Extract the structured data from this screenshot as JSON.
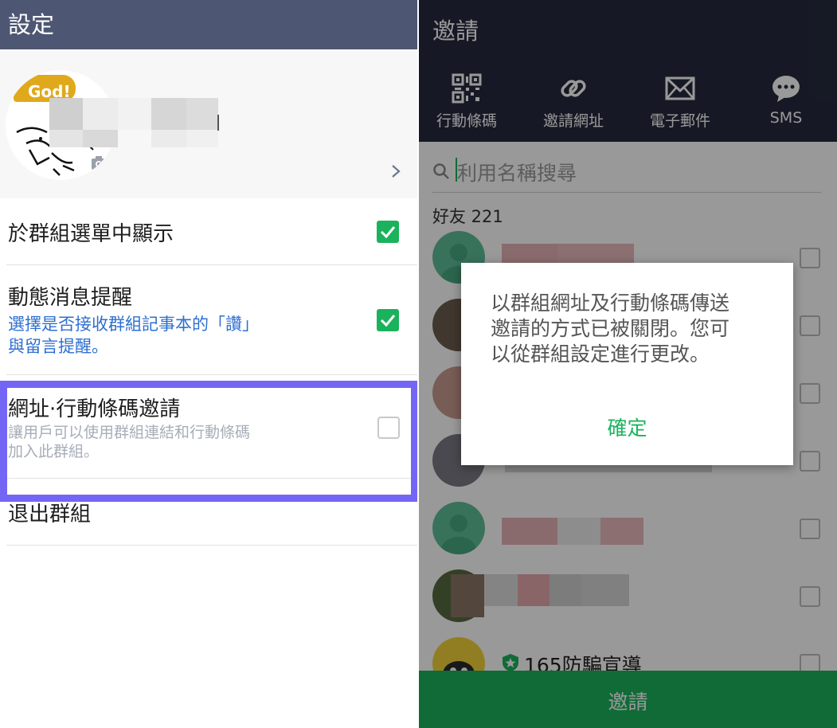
{
  "left": {
    "header": {
      "title": "設定"
    },
    "profile": {
      "avatar_badge": "God!",
      "chevron_icon": "chevron-right-icon",
      "camera_icon": "camera-icon"
    },
    "rows": [
      {
        "title": "於群組選單中顯示",
        "checked": true
      },
      {
        "title": "動態消息提醒",
        "subtitle": "選擇是否接收群組記事本的「讚」與留言提醒。",
        "checked": true
      },
      {
        "title": "網址·行動條碼邀請",
        "subtitle": "讓用戶可以使用群組連結和行動條碼加入此群組。",
        "checked": false
      },
      {
        "title": "退出群組"
      }
    ],
    "subtitle_lines": {
      "row1_line1": "選擇是否接收群組記事本的「讚」",
      "row1_line2": "與留言提醒。",
      "row2_line1": "讓用戶可以使用群組連結和行動條碼",
      "row2_line2": "加入此群組。"
    },
    "colors": {
      "header": "#4d5672",
      "check_on": "#1bb25c",
      "subtitle_blue": "#2d6fd1",
      "subtitle_gray": "#a7adb8",
      "highlight": "#7466f4"
    }
  },
  "right": {
    "header": {
      "title": "邀請"
    },
    "share_options": [
      {
        "label": "行動條碼",
        "icon": "qr-code-icon"
      },
      {
        "label": "邀請網址",
        "icon": "link-icon"
      },
      {
        "label": "電子郵件",
        "icon": "envelope-icon"
      },
      {
        "label": "SMS",
        "icon": "sms-bubble-icon"
      }
    ],
    "search": {
      "placeholder": "利用名稱搜尋",
      "icon": "search-icon"
    },
    "friends_label": "好友 221",
    "visible_friend_name": "165防騙宣導",
    "invite_button": "邀請",
    "dialog": {
      "line1": "以群組網址及行動條碼傳送",
      "line2": "邀請的方式已被關閉。您可",
      "line3": "以從群組設定進行更改。",
      "confirm": "確定"
    },
    "colors": {
      "header": "#252b3e",
      "accent": "#1bb25c"
    }
  }
}
